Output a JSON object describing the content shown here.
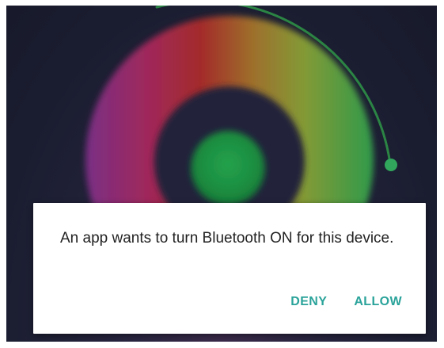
{
  "background": {
    "wheel_colors": [
      "#8a2c7a",
      "#a3262c",
      "#9c6a2a",
      "#8a9a35",
      "#2d9a4d"
    ],
    "inner_dark": "#20233a",
    "center_green": "#1f9244",
    "knob_color": "#31a55c"
  },
  "dialog": {
    "message": "An app wants to turn Bluetooth ON for this device.",
    "deny_label": "DENY",
    "allow_label": "ALLOW",
    "accent_color": "#2aa39a"
  }
}
